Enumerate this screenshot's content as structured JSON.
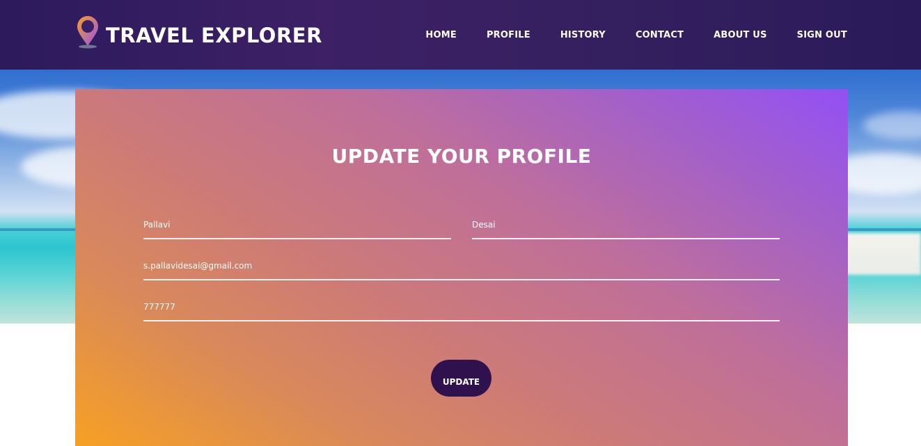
{
  "header": {
    "brand": "TRAVEL EXPLORER",
    "nav": [
      {
        "label": "HOME"
      },
      {
        "label": "PROFILE"
      },
      {
        "label": "HISTORY"
      },
      {
        "label": "CONTACT"
      },
      {
        "label": "ABOUT US"
      },
      {
        "label": "SIGN OUT"
      }
    ]
  },
  "form": {
    "title": "UPDATE YOUR PROFILE",
    "first_name": "Pallavi",
    "last_name": "Desai",
    "email": "s.pallavidesai@gmail.com",
    "phone": "777777",
    "submit_label": "UPDATE"
  },
  "colors": {
    "header_bg": "#2c1a5c",
    "card_gradient_start": "#f7a024",
    "card_gradient_end": "#9350f5",
    "button_bg": "#2f124d"
  },
  "icons": {
    "logo": "map-pin-icon"
  }
}
